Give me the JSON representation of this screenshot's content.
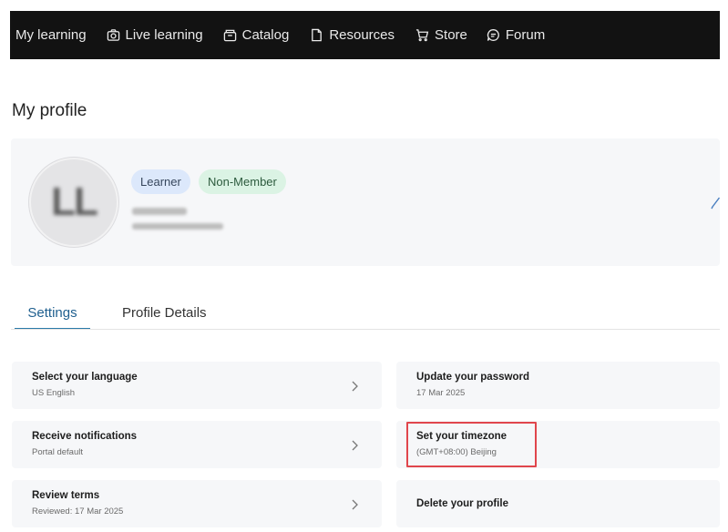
{
  "nav": {
    "items": [
      {
        "label": "My learning",
        "icon": "none"
      },
      {
        "label": "Live learning",
        "icon": "camera-icon"
      },
      {
        "label": "Catalog",
        "icon": "catalog-icon"
      },
      {
        "label": "Resources",
        "icon": "document-icon"
      },
      {
        "label": "Store",
        "icon": "cart-icon"
      },
      {
        "label": "Forum",
        "icon": "chat-bubble-icon"
      }
    ]
  },
  "page": {
    "title": "My profile"
  },
  "profile": {
    "avatar_initials": "LL",
    "badges": [
      "Learner",
      "Non-Member"
    ]
  },
  "tabs": [
    {
      "label": "Settings",
      "active": true
    },
    {
      "label": "Profile Details",
      "active": false
    }
  ],
  "settings": {
    "language": {
      "title": "Select your language",
      "value": "US English"
    },
    "notifications": {
      "title": "Receive notifications",
      "value": "Portal default"
    },
    "terms": {
      "title": "Review terms",
      "value": "Reviewed: 17 Mar 2025"
    },
    "password": {
      "title": "Update your password",
      "value": "17 Mar 2025"
    },
    "timezone": {
      "title": "Set your timezone",
      "value": "(GMT+08:00) Beijing"
    },
    "delete": {
      "title": "Delete your profile"
    }
  },
  "colors": {
    "topbar": "#121212",
    "accent": "#2b7aa8",
    "highlight": "#e0464c",
    "learner_badge": "#dce8fb",
    "member_badge": "#dbf3e4"
  }
}
